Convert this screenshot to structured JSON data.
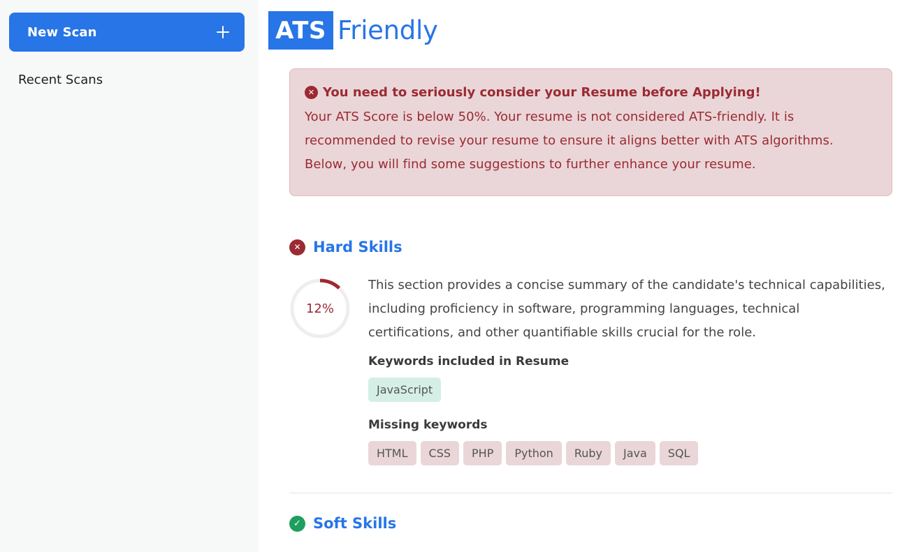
{
  "sidebar": {
    "new_scan_label": "New Scan",
    "recent_scans_label": "Recent Scans"
  },
  "logo": {
    "ats": "ATS",
    "friendly": "Friendly"
  },
  "alert": {
    "title": "You need to seriously consider your Resume before Applying!",
    "body": "Your ATS Score is below 50%. Your resume is not considered ATS-friendly. It is recommended to revise your resume to ensure it aligns better with ATS algorithms. Below, you will find some suggestions to further enhance your resume.",
    "icon": "x-circle-icon",
    "color": "#9b2a33"
  },
  "hard_skills": {
    "title": "Hard Skills",
    "status": "fail",
    "score_text": "12%",
    "score_fraction": 0.12,
    "description": "This section provides a concise summary of the candidate's technical capabilities, including proficiency in software, programming languages, technical certifications, and other quantifiable skills crucial for the role.",
    "included_label": "Keywords included in Resume",
    "included": [
      "JavaScript"
    ],
    "missing_label": "Missing keywords",
    "missing": [
      "HTML",
      "CSS",
      "PHP",
      "Python",
      "Ruby",
      "Java",
      "SQL"
    ]
  },
  "soft_skills": {
    "title": "Soft Skills",
    "status": "pass"
  },
  "colors": {
    "accent": "#2775e6",
    "danger": "#9b2a33",
    "success": "#1e9f5e"
  }
}
